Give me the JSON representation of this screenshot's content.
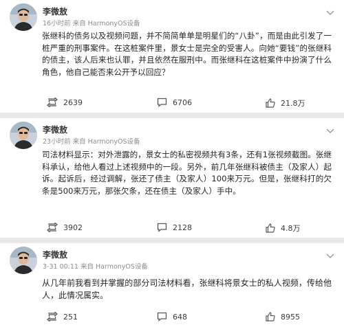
{
  "posts": [
    {
      "author": "李微敖",
      "meta": "16小时前 来自 HarmonyOS设备",
      "text": "张继科的债务以及视频问题，并不简简单单是明星们的“八卦”，而是由此引发了一桩严重的刑事案件。在这桩案件里，景女士是完全的受害人。向她“要钱”的张继科的债主，该人后来也认罪，并且依然在服刑中。而张继科在这桩案件中扮演了什么角色，他自己能否来公开予以回应？",
      "reposts": "2639",
      "comments": "6706",
      "likes": "21.8万"
    },
    {
      "author": "李微敖",
      "meta": "23小时前 来自 HarmonyOS设备",
      "text": "司法材料显示：对外泄露的，景女士的私密视频共有3条，还有1张视频截图。张继科承认，给他人看过上述视频中的一段。另外，前几年张继科被债主（及家人）起诉。起诉后，经过调解，张还了债主（及家人）100来万元。但是，张继科打的欠条是500来万元，那张欠条，还在债主（及家人）手中。",
      "reposts": "3902",
      "comments": "2128",
      "likes": "4.8万"
    },
    {
      "author": "李微敖",
      "meta": "3-31 00:11 来自 HarmonyOS设备",
      "text": "从几年前我看到并掌握的部分司法材料看，张继科将景女士的私人视频，传给他人，此情况属实。",
      "reposts": "251",
      "comments": "648",
      "likes": "8955"
    }
  ],
  "icons": {
    "repost": "repost-icon",
    "comment": "comment-icon",
    "like": "thumbs-up-icon",
    "more": "chevron-down-icon",
    "avatar": "avatar"
  },
  "colors": {
    "background": "#e9e9ec",
    "card": "#ffffff",
    "text": "#262626",
    "meta": "#8c8c8c"
  }
}
